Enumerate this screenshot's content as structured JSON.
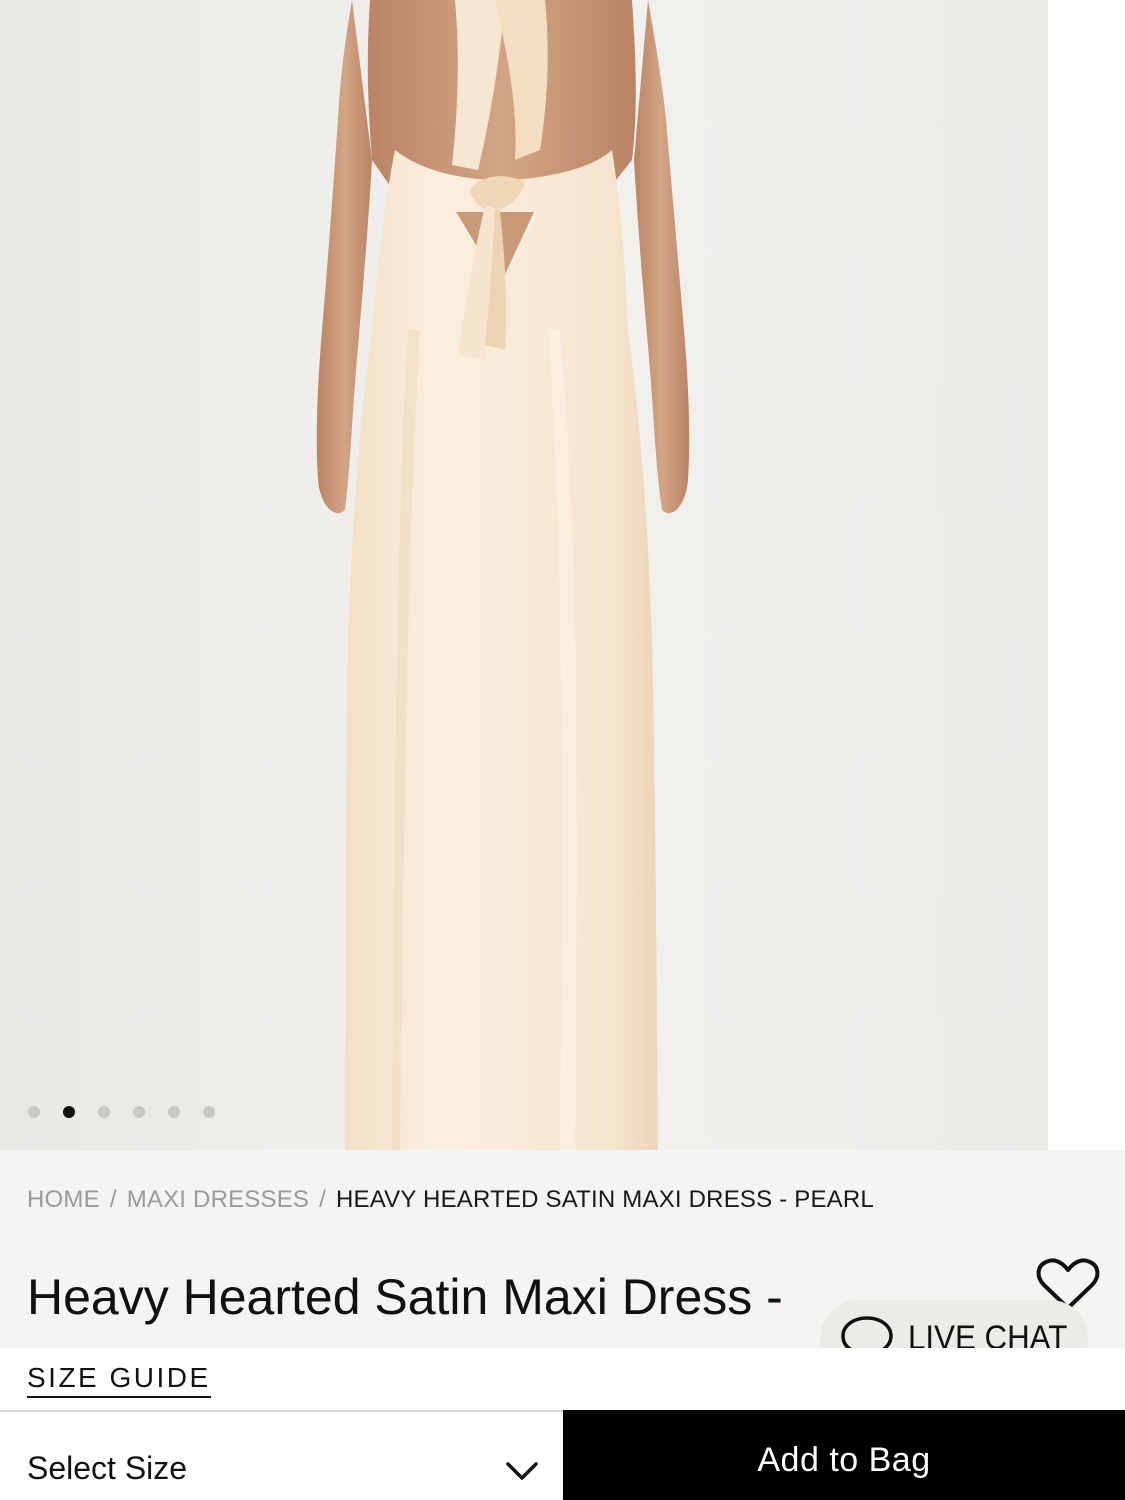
{
  "gallery": {
    "image_alt": "Heavy Hearted Satin Maxi Dress - Pearl, back view",
    "slide_count": 6,
    "active_index": 1
  },
  "breadcrumb": {
    "items": [
      "HOME",
      "MAXI DRESSES"
    ],
    "separator": "/",
    "current": "HEAVY HEARTED SATIN MAXI DRESS - PEARL"
  },
  "product": {
    "title": "Heavy Hearted Satin Maxi Dress - Pearl"
  },
  "wishlist": {
    "icon": "heart-outline-icon"
  },
  "live_chat": {
    "label": "LIVE CHAT",
    "icon": "chat-bubble-icon"
  },
  "size_guide": {
    "label": "SIZE GUIDE"
  },
  "select_size": {
    "label": "Select Size",
    "icon": "chevron-down-icon"
  },
  "add_to_bag": {
    "label": "Add to Bag"
  },
  "colors": {
    "background_image": "#efeeeb",
    "dress": "#f6e8d4",
    "skin": "#c99a7a",
    "button_bg": "#000000",
    "info_bg": "#f5f4f2"
  }
}
